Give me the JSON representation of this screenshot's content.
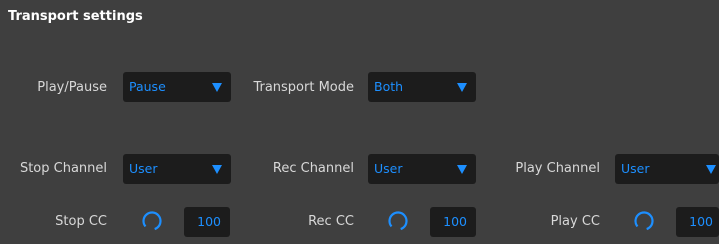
{
  "section": {
    "title": "Transport settings"
  },
  "row1": {
    "play_pause": {
      "label": "Play/Pause",
      "value": "Pause"
    },
    "transport_mode": {
      "label": "Transport Mode",
      "value": "Both"
    }
  },
  "row2": {
    "stop_channel": {
      "label": "Stop Channel",
      "value": "User"
    },
    "rec_channel": {
      "label": "Rec Channel",
      "value": "User"
    },
    "play_channel": {
      "label": "Play Channel",
      "value": "User"
    }
  },
  "row3": {
    "stop_cc": {
      "label": "Stop CC",
      "value": "100"
    },
    "rec_cc": {
      "label": "Rec CC",
      "value": "100"
    },
    "play_cc": {
      "label": "Play CC",
      "value": "100"
    }
  },
  "icons": {
    "dropdown_arrow": "triangle-down-icon",
    "knob": "knob-icon"
  },
  "colors": {
    "background": "#3f3f3f",
    "field_background": "#1c1c1c",
    "accent": "#1d8fff",
    "label_text": "#d8d8d8",
    "title_text": "#ffffff"
  }
}
